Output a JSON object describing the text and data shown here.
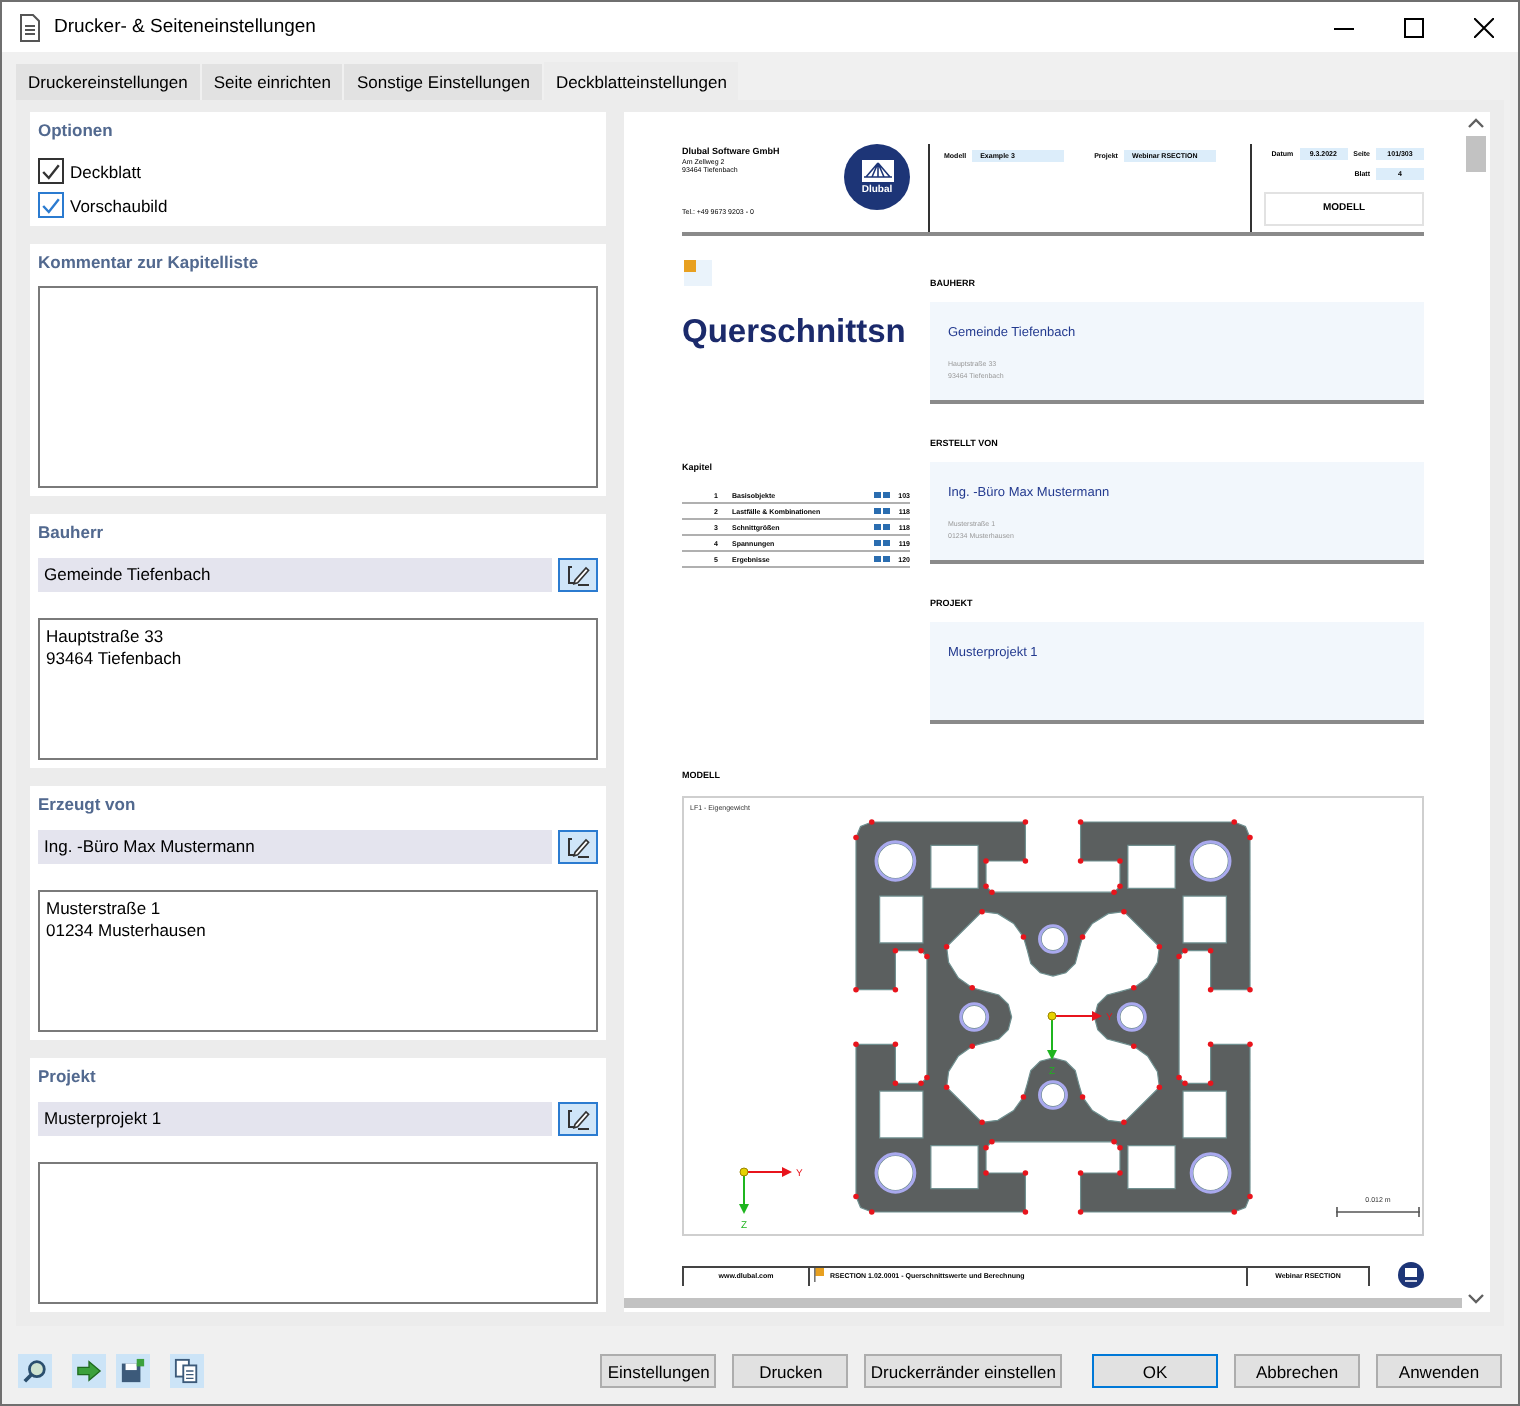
{
  "window": {
    "title": "Drucker- & Seiteneinstellungen"
  },
  "tabs": [
    {
      "label": "Druckereinstellungen",
      "selected": false
    },
    {
      "label": "Seite einrichten",
      "selected": false
    },
    {
      "label": "Sonstige Einstellungen",
      "selected": false
    },
    {
      "label": "Deckblatteinstellungen",
      "selected": true
    }
  ],
  "options": {
    "title": "Optionen",
    "checkboxes": [
      {
        "label": "Deckblatt",
        "checked": true,
        "hovered": false
      },
      {
        "label": "Vorschaubild",
        "checked": true,
        "hovered": true
      }
    ]
  },
  "chapter_comment": {
    "title": "Kommentar zur Kapitelliste"
  },
  "sections": [
    {
      "title": "Bauherr",
      "name": "Gemeinde Tiefenbach",
      "address": [
        "Hauptstraße 33",
        "93464 Tiefenbach"
      ]
    },
    {
      "title": "Erzeugt von",
      "name": "Ing. -Büro Max Mustermann",
      "address": [
        "Musterstraße 1",
        "01234 Musterhausen"
      ]
    },
    {
      "title": "Projekt",
      "name": "Musterprojekt 1"
    }
  ],
  "preview": {
    "header": {
      "company": "Dlubal Software GmbH",
      "address": [
        "Am Zellweg 2",
        "93464 Tiefenbach"
      ],
      "phone": "Tel.: +49 9673 9203 - 0",
      "logo_text": "Dlubal",
      "fields": [
        {
          "label": "Modell",
          "value": "Example 3"
        },
        {
          "label": "Projekt",
          "value": "Webinar RSECTION"
        }
      ],
      "meta": [
        {
          "label": "Datum",
          "value": "9.3.2022"
        },
        {
          "label": "Seite",
          "value": "101/303"
        },
        {
          "label": "Blatt",
          "value": "4"
        }
      ],
      "sheet_title": "MODELL"
    },
    "title": "Querschnittsn",
    "chapters_title": "Kapitel",
    "chapters": [
      {
        "number": "1",
        "name": "Basisobjekte",
        "page": "103"
      },
      {
        "number": "2",
        "name": "Lastfälle & Kombinationen",
        "page": "118"
      },
      {
        "number": "3",
        "name": "Schnittgrößen",
        "page": "118"
      },
      {
        "number": "4",
        "name": "Spannungen",
        "page": "119"
      },
      {
        "number": "5",
        "name": "Ergebnisse",
        "page": "120"
      }
    ],
    "blocks": [
      {
        "heading": "BAUHERR",
        "name": "Gemeinde Tiefenbach",
        "address": [
          "Hauptstraße 33",
          "93464 Tiefenbach"
        ]
      },
      {
        "heading": "ERSTELLT VON",
        "name": "Ing. -Büro Max Mustermann",
        "address": [
          "Musterstraße 1",
          "01234 Musterhausen"
        ]
      },
      {
        "heading": "PROJEKT",
        "name": "Musterprojekt 1"
      }
    ],
    "model": {
      "heading": "MODELL",
      "caption": "LF1 - Eigengewicht",
      "center_axes": {
        "y_label": "Y",
        "z_label": "Z"
      },
      "global_axes": {
        "y_label": "Y",
        "z_label": "Z"
      },
      "scale": "0.012 m"
    },
    "footer": {
      "website": "www.dlubal.com",
      "program": "RSECTION 1.02.0001 - Querschnittswerte und Berechnung",
      "project": "Webinar RSECTION"
    }
  },
  "buttons": [
    {
      "label": "Einstellungen",
      "default": false
    },
    {
      "label": "Drucken",
      "default": false
    },
    {
      "label": "Druckerränder einstellen",
      "default": false
    },
    {
      "label": "OK",
      "default": true
    },
    {
      "label": "Abbrechen",
      "default": false
    },
    {
      "label": "Anwenden",
      "default": false
    }
  ]
}
